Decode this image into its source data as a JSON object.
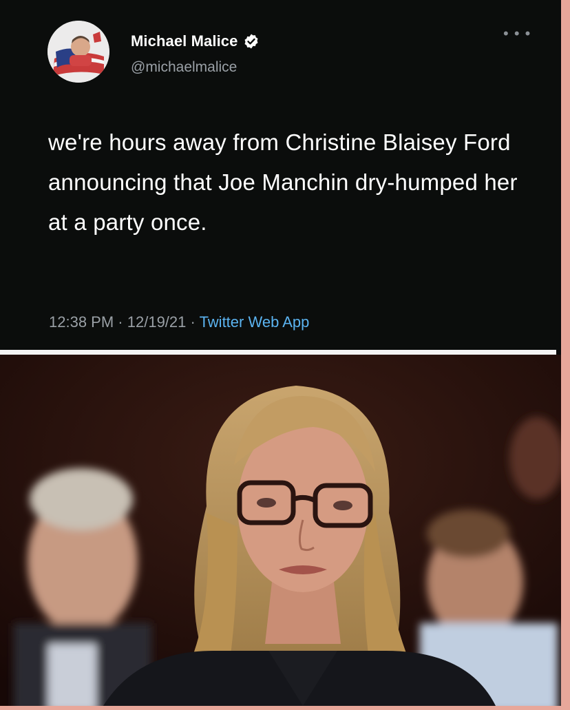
{
  "tweet": {
    "display_name": "Michael Malice",
    "handle": "@michaelmalice",
    "text": "we're hours away from Christine Blaisey Ford announcing that Joe Manchin dry-humped her at a party once.",
    "time": "12:38 PM",
    "separator": "·",
    "date": "12/19/21",
    "source": "Twitter Web App",
    "more_icon": "more-options-icon",
    "verified_icon": "verified-badge-icon",
    "accent_color": "#5bb3f0"
  },
  "photo": {
    "subject": "photo"
  }
}
